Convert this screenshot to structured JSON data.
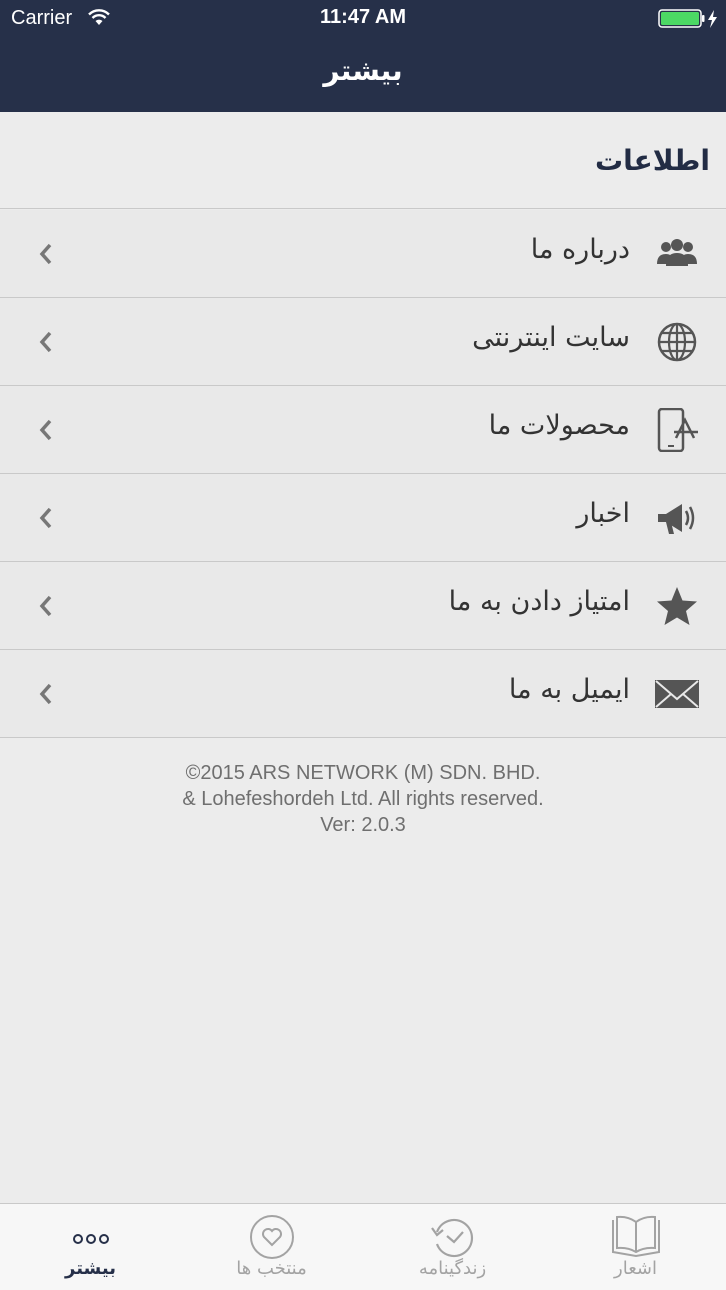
{
  "status_bar": {
    "carrier": "Carrier",
    "time": "11:47 AM"
  },
  "nav": {
    "title": "بیشتر"
  },
  "section": {
    "title": "اطلاعات"
  },
  "rows": [
    {
      "label": "درباره ما",
      "icon": "group-icon"
    },
    {
      "label": "سایت اینترنتی",
      "icon": "globe-icon"
    },
    {
      "label": "محصولات ما",
      "icon": "app-store-icon"
    },
    {
      "label": "اخبار",
      "icon": "megaphone-icon"
    },
    {
      "label": "امتیاز دادن به ما",
      "icon": "star-icon"
    },
    {
      "label": "ایمیل به ما",
      "icon": "envelope-icon"
    }
  ],
  "footer": {
    "line1": "©2015 ARS NETWORK (M) SDN. BHD.",
    "line2": "& Lohefeshordeh Ltd. All rights reserved.",
    "line3": "Ver: 2.0.3"
  },
  "tabs": [
    {
      "label": "بیشتر",
      "icon": "more-dots-icon",
      "active": true
    },
    {
      "label": "منتخب ها",
      "icon": "heart-icon",
      "active": false
    },
    {
      "label": "زندگینامه",
      "icon": "history-icon",
      "active": false
    },
    {
      "label": "اشعار",
      "icon": "book-icon",
      "active": false
    }
  ],
  "colors": {
    "nav_background": "#263049",
    "background": "#ececec",
    "battery": "#4cd964"
  }
}
